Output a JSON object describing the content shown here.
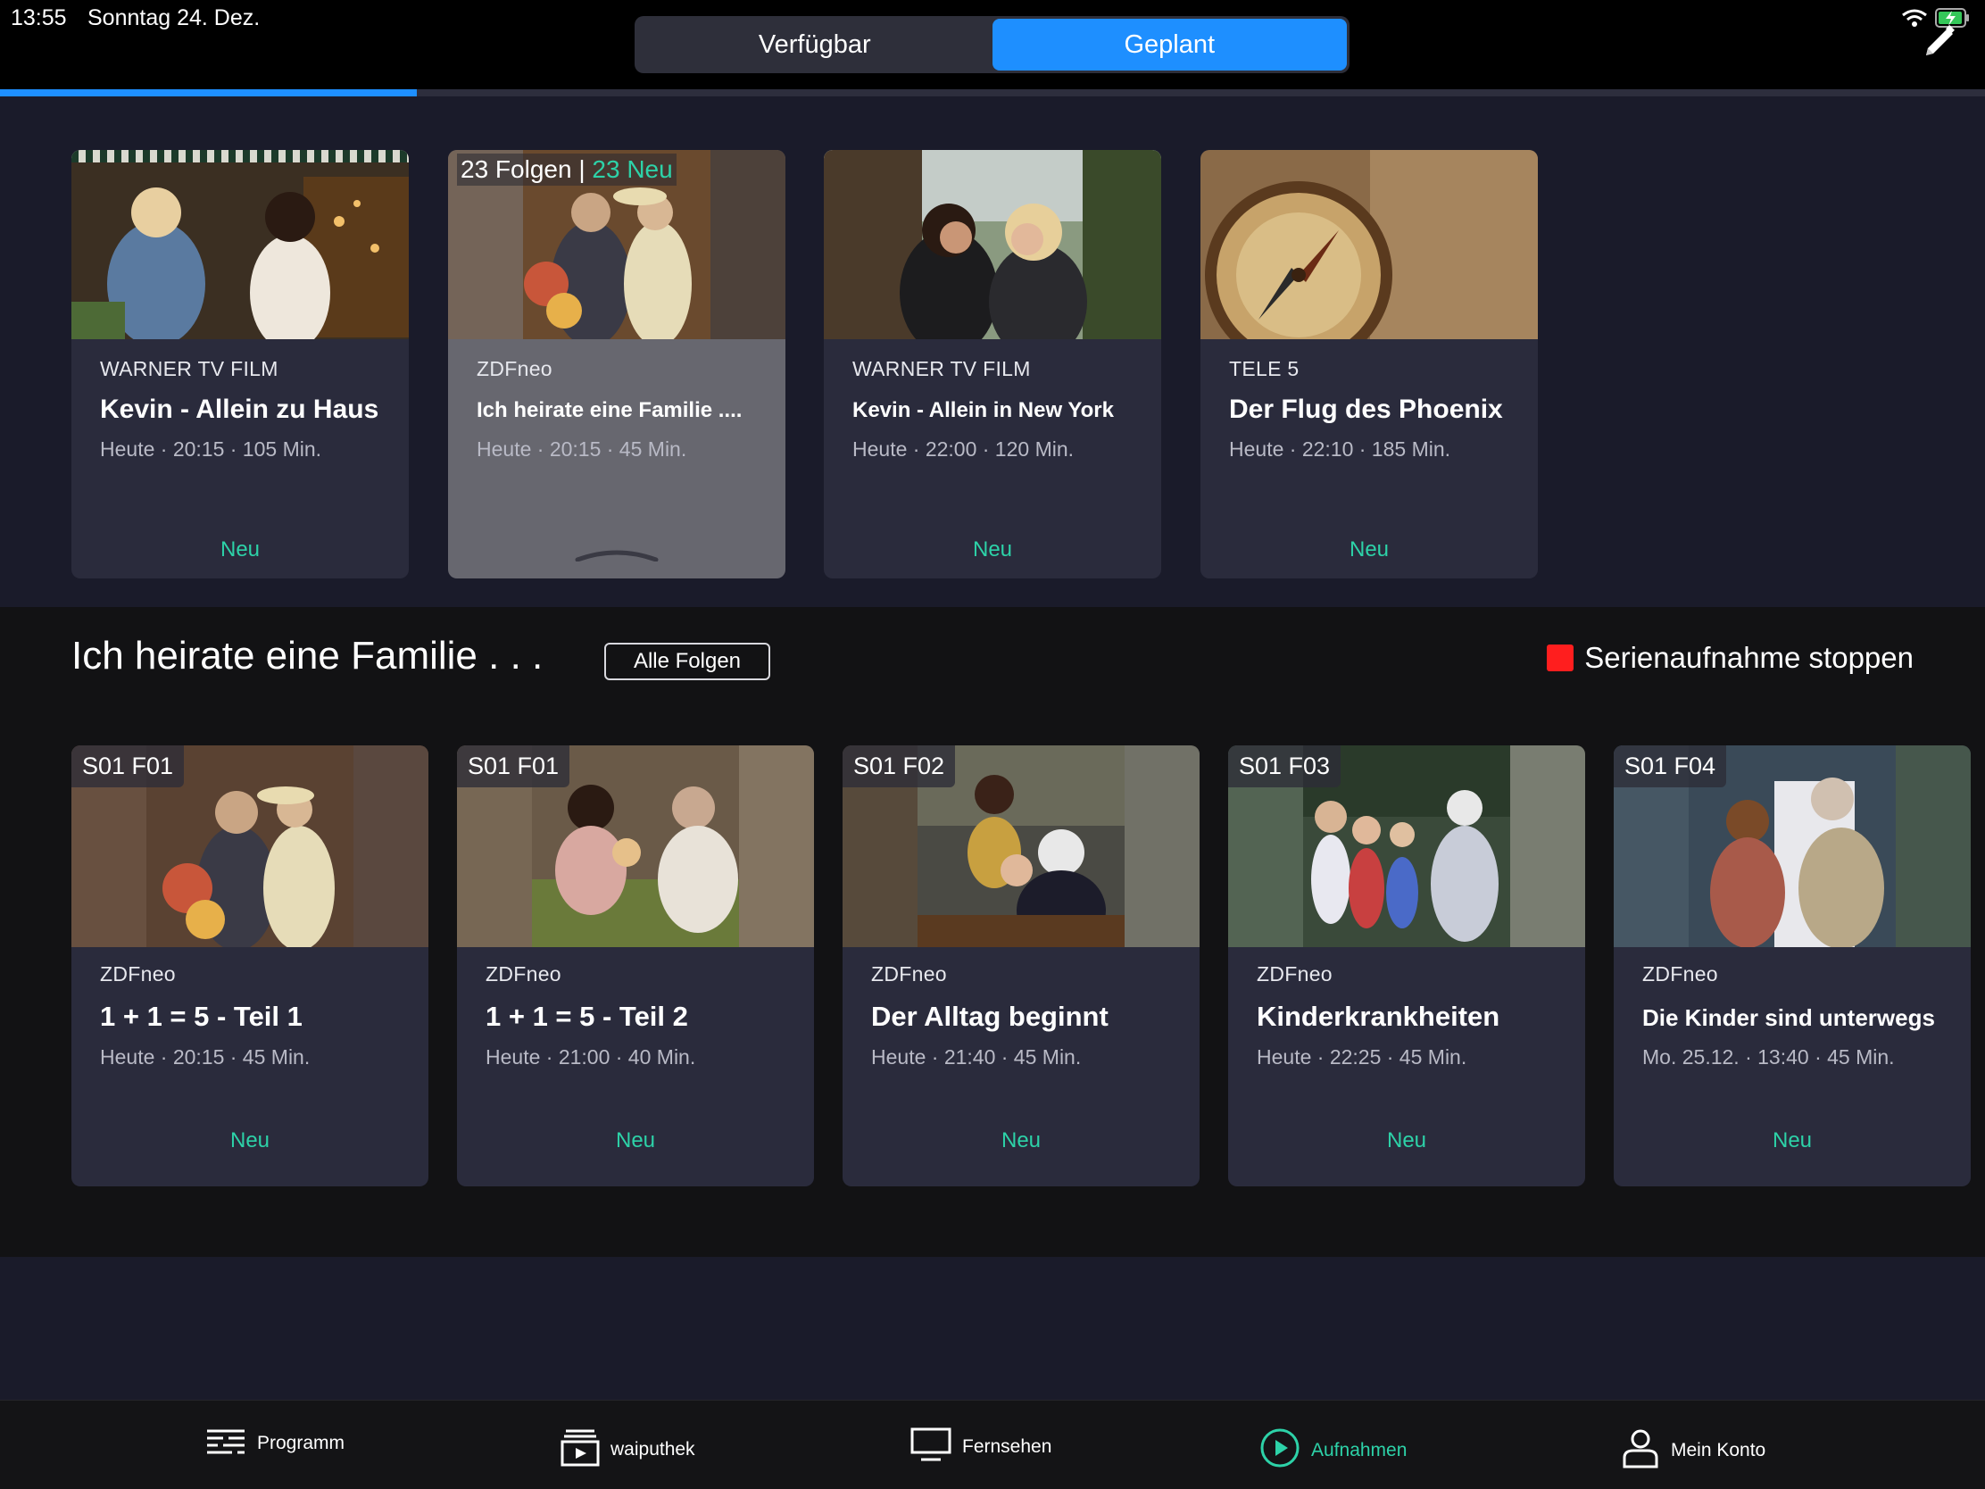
{
  "status": {
    "time": "13:55",
    "date": "Sonntag 24. Dez."
  },
  "segment": {
    "tabs": [
      {
        "label": "Verfügbar",
        "active": false
      },
      {
        "label": "Geplant",
        "active": true
      }
    ]
  },
  "progress": {
    "fraction": 0.21
  },
  "colors": {
    "accent_blue": "#1e8fff",
    "accent_green": "#2dd2a8",
    "stop_red": "#ff1e1e"
  },
  "top_cards": [
    {
      "channel": "WARNER TV FILM",
      "title": "Kevin - Allein zu Haus",
      "meta": "Heute · 20:15 · 105 Min.",
      "badge": "Neu"
    },
    {
      "folgen": "23 Folgen",
      "sep": "|",
      "neu_count": "23 Neu",
      "channel": "ZDFneo",
      "title": "Ich heirate eine Familie ....",
      "meta": "Heute · 20:15 · 45 Min.",
      "badge": ""
    },
    {
      "channel": "WARNER TV FILM",
      "title": "Kevin - Allein in New York",
      "meta": "Heute · 22:00 · 120 Min.",
      "badge": "Neu"
    },
    {
      "channel": "TELE 5",
      "title": "Der Flug des Phoenix",
      "meta": "Heute · 22:10 · 185 Min.",
      "badge": "Neu"
    }
  ],
  "section": {
    "title": "Ich heirate eine Familie . . .",
    "all_episodes": "Alle Folgen",
    "stop_label": "Serienaufnahme stoppen"
  },
  "episodes": [
    {
      "code": "S01 F01",
      "channel": "ZDFneo",
      "title": "1 + 1 = 5  - Teil 1",
      "meta": "Heute · 20:15 · 45 Min.",
      "badge": "Neu"
    },
    {
      "code": "S01 F01",
      "channel": "ZDFneo",
      "title": "1 + 1 = 5 - Teil 2",
      "meta": "Heute · 21:00 · 40 Min.",
      "badge": "Neu"
    },
    {
      "code": "S01 F02",
      "channel": "ZDFneo",
      "title": "Der Alltag beginnt",
      "meta": "Heute · 21:40 · 45 Min.",
      "badge": "Neu"
    },
    {
      "code": "S01 F03",
      "channel": "ZDFneo",
      "title": "Kinderkrankheiten",
      "meta": "Heute · 22:25 · 45 Min.",
      "badge": "Neu"
    },
    {
      "code": "S01 F04",
      "channel": "ZDFneo",
      "title": "Die Kinder sind unterwegs",
      "meta": "Mo. 25.12. · 13:40 · 45 Min.",
      "badge": "Neu"
    }
  ],
  "nav": [
    {
      "label": "Programm",
      "icon": "programm-icon"
    },
    {
      "label": "waiputhek",
      "icon": "waiputhek-icon"
    },
    {
      "label": "Fernsehen",
      "icon": "tv-icon"
    },
    {
      "label": "Aufnahmen",
      "icon": "play-circle-icon",
      "active": true
    },
    {
      "label": "Mein Konto",
      "icon": "user-icon"
    }
  ]
}
